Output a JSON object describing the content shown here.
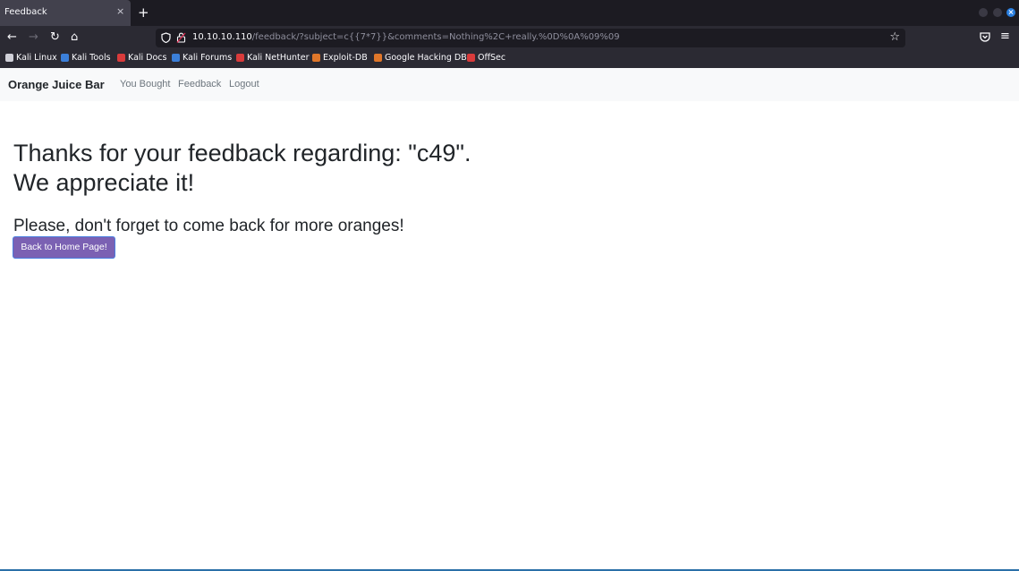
{
  "browser": {
    "tab_title": "Feedback",
    "tab_close": "×",
    "new_tab": "+",
    "url_host": "10.10.10.110",
    "url_rest": "/feedback/?subject=c{{7*7}}&comments=Nothing%2C+really.%0D%0A%09%09",
    "bookmarks": [
      {
        "label": "Kali Linux",
        "color": "#3b7fd9"
      },
      {
        "label": "Kali Tools",
        "color": "#3b7fd9"
      },
      {
        "label": "Kali Docs",
        "color": "#d93b3b"
      },
      {
        "label": "Kali Forums",
        "color": "#3b7fd9"
      },
      {
        "label": "Kali NetHunter",
        "color": "#d93b3b"
      },
      {
        "label": "Exploit-DB",
        "color": "#e0772a"
      },
      {
        "label": "Google Hacking DB",
        "color": "#e0772a"
      },
      {
        "label": "OffSec",
        "color": "#d93b3b"
      }
    ]
  },
  "site": {
    "brand": "Orange Juice Bar",
    "nav": {
      "you_bought": "You Bought",
      "feedback": "Feedback",
      "logout": "Logout"
    },
    "heading_line1": "Thanks for your feedback regarding: \"c49\".",
    "heading_line2": "We appreciate it!",
    "subheading": "Please, don't forget to come back for more oranges!",
    "home_button": "Back to Home Page!",
    "button_color": "#7b61b3"
  }
}
